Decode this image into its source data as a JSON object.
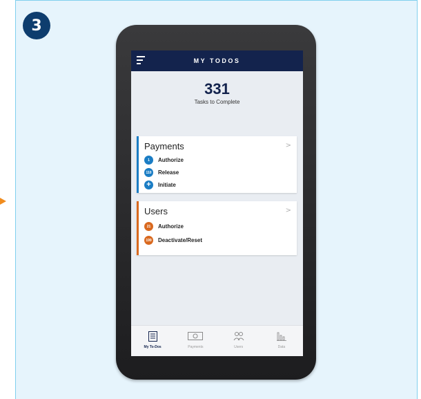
{
  "step": {
    "number": "3"
  },
  "header": {
    "title": "MY TODOS"
  },
  "summary": {
    "count": "331",
    "label": "Tasks to Complete"
  },
  "payments": {
    "title": "Payments",
    "accent": "#1b7dc4",
    "items": [
      {
        "badge": "1",
        "label": "Authorize"
      },
      {
        "badge": "110",
        "label": "Release"
      },
      {
        "badge": "+",
        "label": "Initiate"
      }
    ]
  },
  "users": {
    "title": "Users",
    "accent": "#d9691f",
    "items": [
      {
        "badge": "21",
        "label": "Authorize"
      },
      {
        "badge": "199",
        "label": "Deactivate/Reset"
      }
    ]
  },
  "tabs": [
    {
      "label": "My To-Dos",
      "icon": "list-icon",
      "active": true
    },
    {
      "label": "Payments",
      "icon": "cash-icon",
      "active": false
    },
    {
      "label": "Users",
      "icon": "users-icon",
      "active": false
    },
    {
      "label": "Data",
      "icon": "bar-chart-icon",
      "active": false
    }
  ],
  "colors": {
    "header": "#13234d",
    "panel": "#e6f4fc",
    "badge": "#0e3d6e",
    "arrow": "#f08c1e"
  }
}
